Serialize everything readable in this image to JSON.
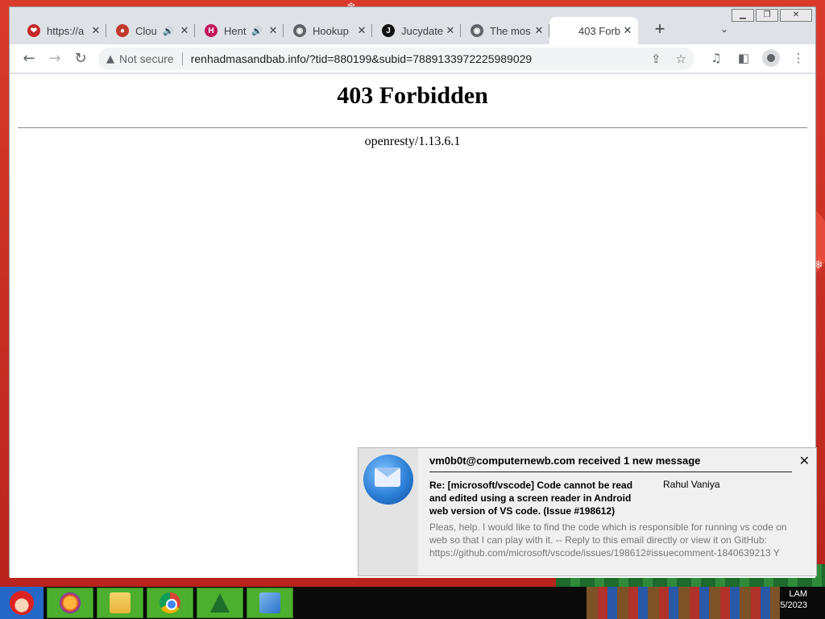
{
  "browser": {
    "tabs": [
      {
        "title": "https://a",
        "icon": "lips-icon",
        "icon_color": "#c62828",
        "audio": false,
        "active": false
      },
      {
        "title": "Clou",
        "icon": "speech-bubble-icon",
        "icon_color": "#c0392b",
        "audio": true,
        "active": false
      },
      {
        "title": "Hent",
        "icon": "h-logo-icon",
        "icon_color": "#c2185b",
        "audio": true,
        "active": false
      },
      {
        "title": "Hookup",
        "icon": "globe-icon",
        "icon_color": "#5f6368",
        "audio": false,
        "active": false
      },
      {
        "title": "Jucydate",
        "icon": "j-logo-icon",
        "icon_color": "#111111",
        "audio": false,
        "active": false
      },
      {
        "title": "The mos",
        "icon": "globe-icon",
        "icon_color": "#5f6368",
        "audio": false,
        "active": false
      },
      {
        "title": "403 Forb",
        "icon": "",
        "icon_color": "",
        "audio": false,
        "active": true
      }
    ],
    "new_tab_label": "+",
    "tab_search_glyph": "⌄",
    "omnibox": {
      "security_label": "Not secure",
      "url": "renhadmasandbab.info/?tid=880199&subid=7889133972225989029"
    }
  },
  "page": {
    "heading": "403 Forbidden",
    "server": "openresty/1.13.6.1"
  },
  "notification": {
    "header": "vm0b0t@computernewb.com received 1 new message",
    "subject": "Re: [microsoft/vscode] Code cannot be read and edited using a screen reader in Android web version of VS code. (Issue #198612)",
    "sender": "Rahul Vaniya",
    "preview": "Pleas, help. I would like to find the code which is responsible for running vs code on web so that I can play with it. -- Reply to this email directly or view it on GitHub: https://github.com/microsoft/vscode/issues/198612#issuecomment-1840639213 Y"
  },
  "taskbar": {
    "items": [
      "firefox-icon",
      "file-explorer-icon",
      "chrome-icon",
      "christmas-tree-icon",
      "photo-viewer-icon"
    ],
    "clock_time": "LAM",
    "clock_date": "5/2023"
  }
}
